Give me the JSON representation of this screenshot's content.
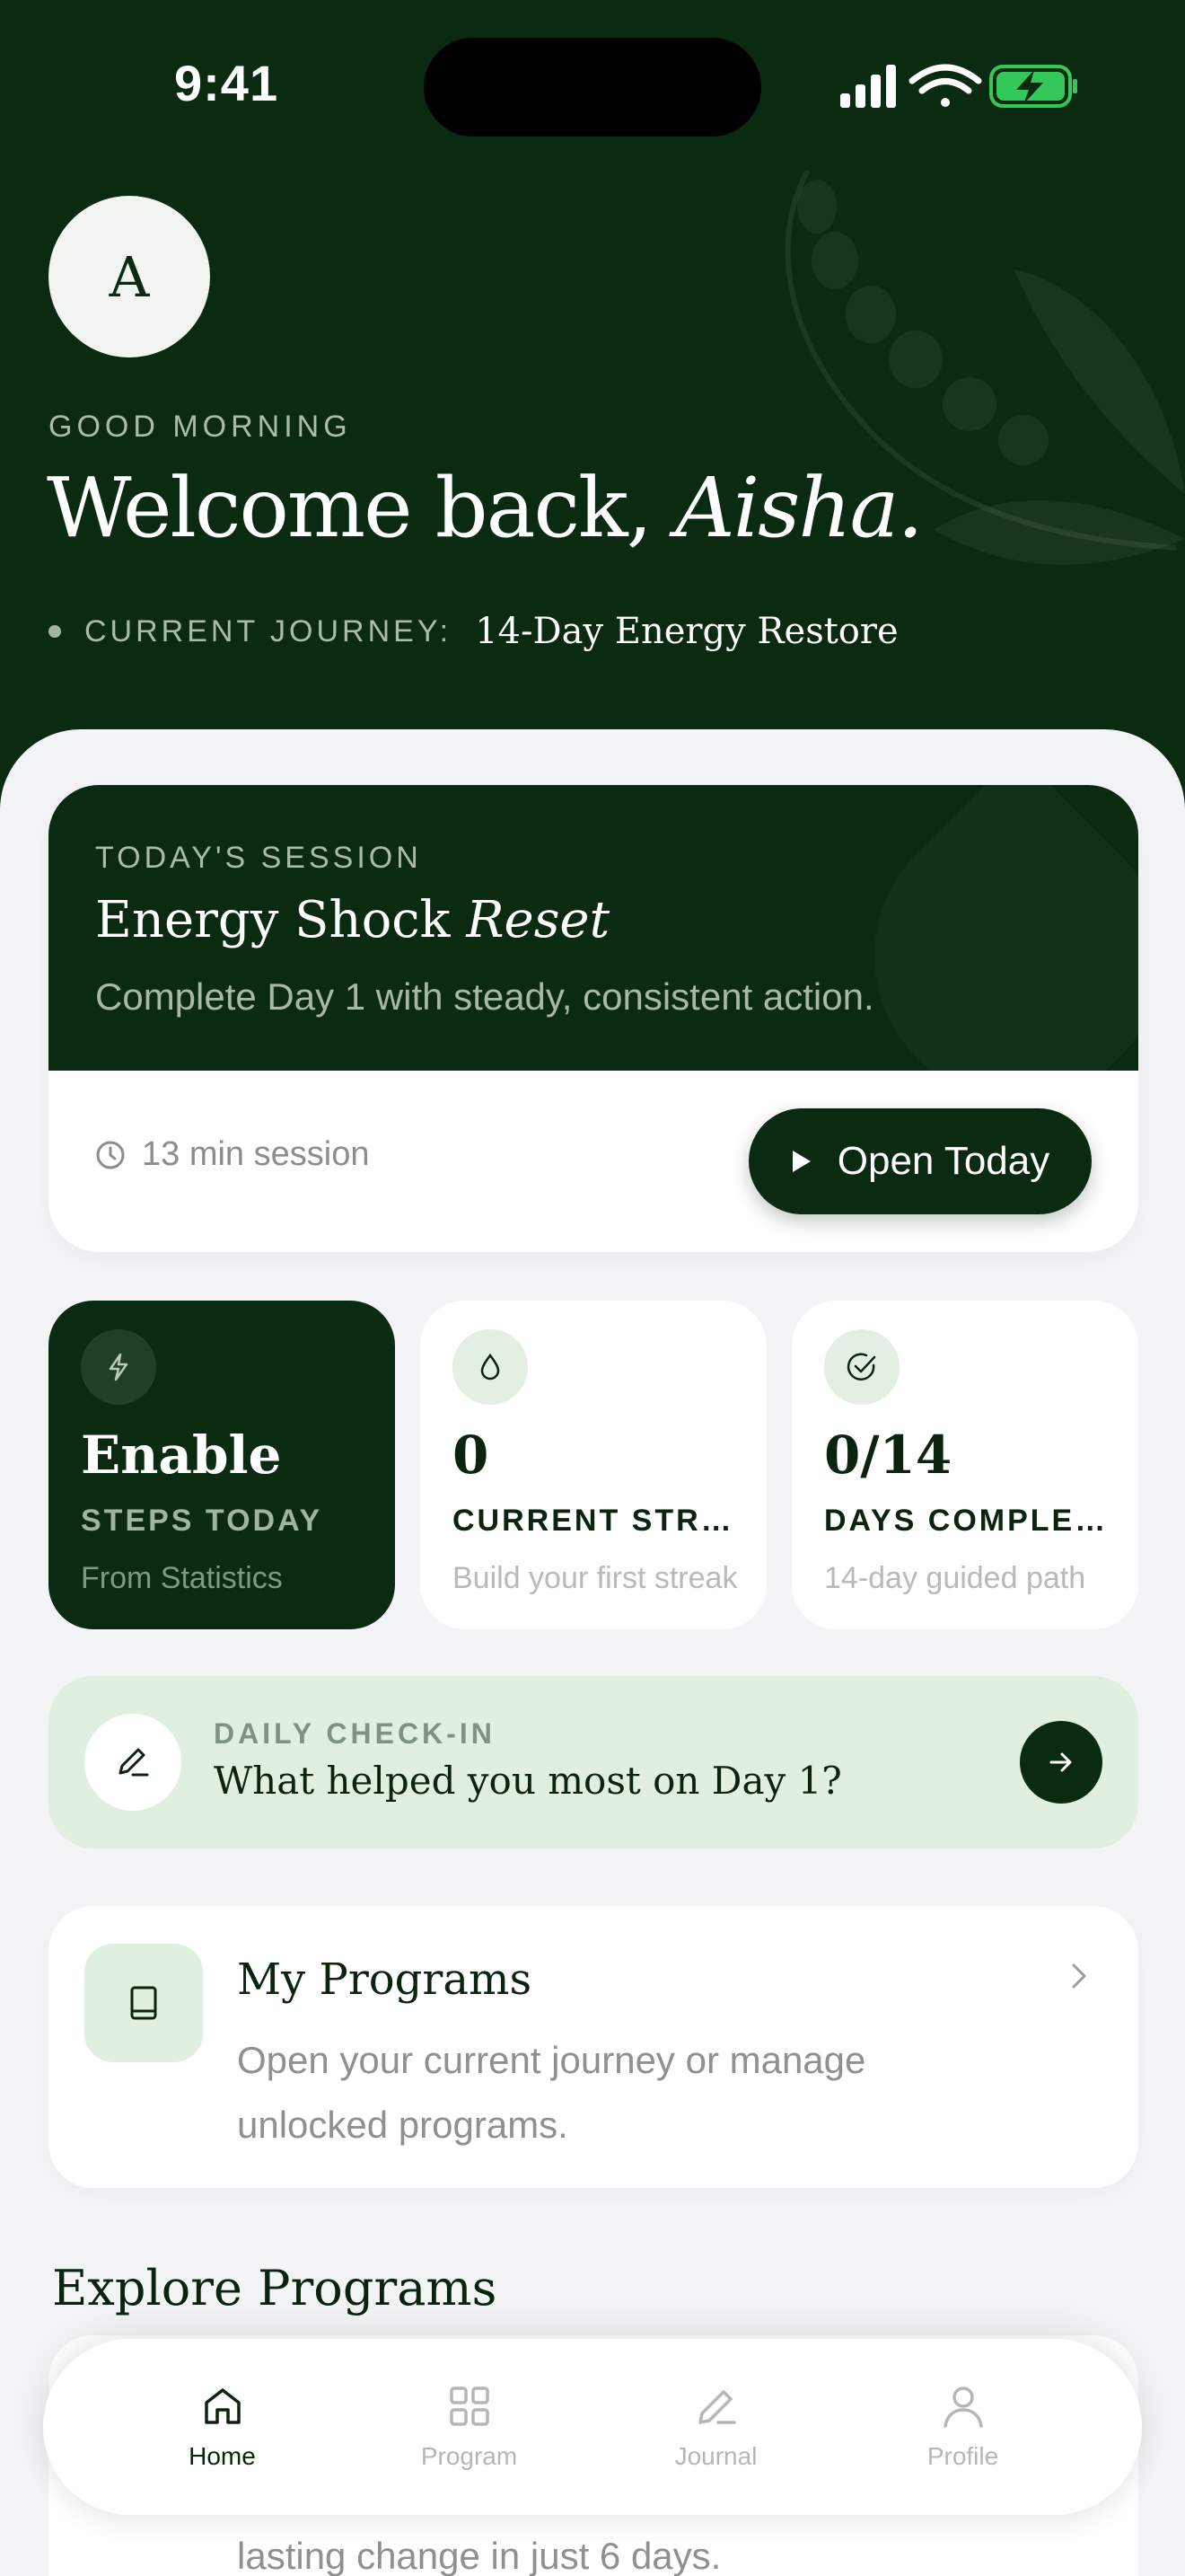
{
  "status_bar": {
    "time": "9:41"
  },
  "header": {
    "avatar_initial": "A",
    "greeting": "GOOD MORNING",
    "welcome_prefix": "Welcome back, ",
    "welcome_name": "Aisha.",
    "journey_label": "CURRENT JOURNEY:",
    "journey_value": "14-Day Energy Restore"
  },
  "session": {
    "kicker": "TODAY'S SESSION",
    "title_plain": "Energy Shock ",
    "title_italic": "Reset",
    "description": "Complete Day 1 with steady, consistent action.",
    "duration": "13 min session",
    "open_label": "Open Today"
  },
  "stats": [
    {
      "icon": "bolt-icon",
      "value": "Enable",
      "label": "STEPS TODAY",
      "sub": "From Statistics"
    },
    {
      "icon": "drop-icon",
      "value": "0",
      "label": "CURRENT STREAK",
      "sub": "Build your first streak"
    },
    {
      "icon": "check-circle-icon",
      "value": "0/14",
      "label": "DAYS COMPLETED",
      "sub": "14-day guided path"
    }
  ],
  "checkin": {
    "kicker": "DAILY CHECK-IN",
    "question": "What helped you most on Day 1?"
  },
  "programs": {
    "title": "My Programs",
    "description": "Open your current journey or manage unlocked programs."
  },
  "explore": {
    "title": "Explore Programs",
    "peek_text": "lasting change in just 6 days."
  },
  "tabs": [
    {
      "label": "Home",
      "active": true
    },
    {
      "label": "Program",
      "active": false
    },
    {
      "label": "Journal",
      "active": false
    },
    {
      "label": "Profile",
      "active": false
    }
  ],
  "colors": {
    "brand_dark": "#0a2a12",
    "accent_light": "#e1efe1",
    "battery_green": "#34c759"
  }
}
